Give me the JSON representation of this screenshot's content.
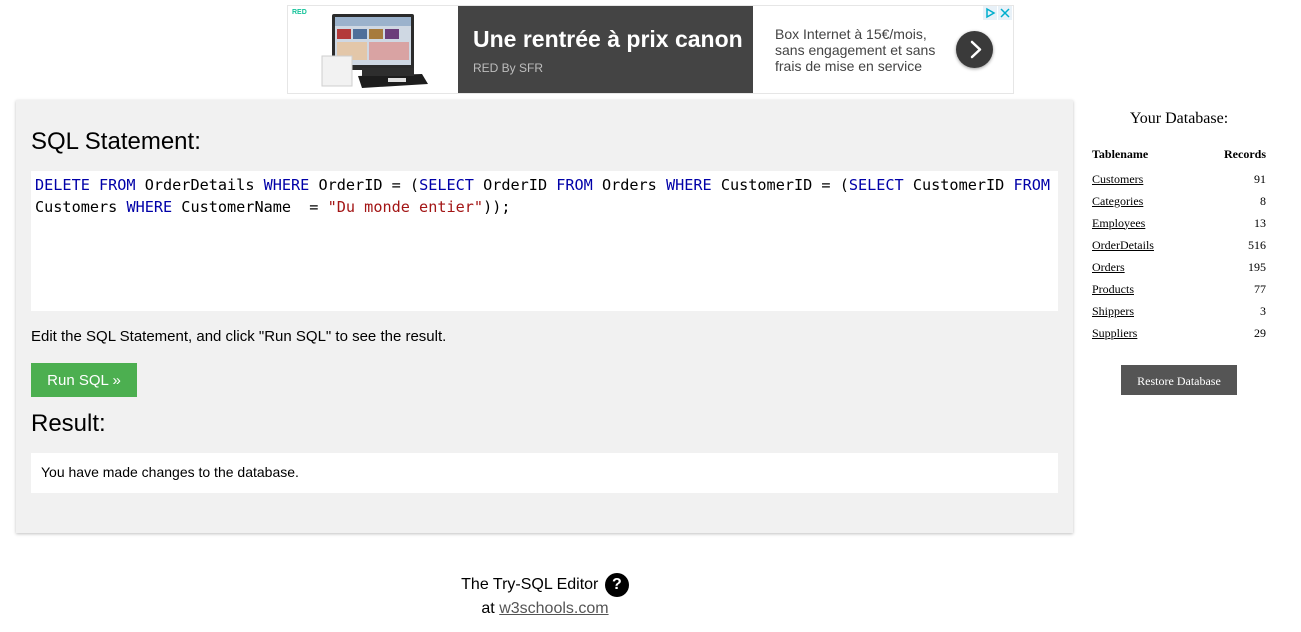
{
  "ad": {
    "logo_mark": "RED",
    "headline": "Une rentrée à prix canon",
    "advertiser": "RED By SFR",
    "body": "Box Internet à 15€/mois, sans engagement et sans frais de mise en service",
    "cta_icon": "chevron-right-icon",
    "colors": {
      "dark_bg": "#444444",
      "brand": "#15c39a"
    }
  },
  "editor": {
    "heading": "SQL Statement:",
    "sql_tokens": [
      {
        "t": "DELETE FROM",
        "k": "kw"
      },
      {
        "t": " OrderDetails ",
        "k": ""
      },
      {
        "t": "WHERE",
        "k": "kw"
      },
      {
        "t": " OrderID = (",
        "k": ""
      },
      {
        "t": "SELECT",
        "k": "kw"
      },
      {
        "t": " OrderID ",
        "k": ""
      },
      {
        "t": "FROM",
        "k": "kw"
      },
      {
        "t": " Orders ",
        "k": ""
      },
      {
        "t": "WHERE",
        "k": "kw"
      },
      {
        "t": " CustomerID = (",
        "k": ""
      },
      {
        "t": "SELECT",
        "k": "kw"
      },
      {
        "t": " CustomerID ",
        "k": ""
      },
      {
        "t": "FROM",
        "k": "kw"
      },
      {
        "t": "\nCustomers ",
        "k": ""
      },
      {
        "t": "WHERE",
        "k": "kw"
      },
      {
        "t": " CustomerName  = ",
        "k": ""
      },
      {
        "t": "\"Du monde entier\"",
        "k": "str"
      },
      {
        "t": "));",
        "k": ""
      }
    ],
    "hint": "Edit the SQL Statement, and click \"Run SQL\" to see the result.",
    "run_label": "Run SQL »",
    "result_heading": "Result:",
    "result_message": "You have made changes to the database.",
    "colors": {
      "run_button": "#4caf50",
      "keyword": "#0000a8",
      "string": "#a31515"
    }
  },
  "database": {
    "title": "Your Database:",
    "col_tablename": "Tablename",
    "col_records": "Records",
    "tables": [
      {
        "name": "Customers",
        "records": "91"
      },
      {
        "name": "Categories",
        "records": "8"
      },
      {
        "name": "Employees",
        "records": "13"
      },
      {
        "name": "OrderDetails",
        "records": "516"
      },
      {
        "name": "Orders",
        "records": "195"
      },
      {
        "name": "Products",
        "records": "77"
      },
      {
        "name": "Shippers",
        "records": "3"
      },
      {
        "name": "Suppliers",
        "records": "29"
      }
    ],
    "restore_label": "Restore Database"
  },
  "footer": {
    "line1": "The Try-SQL Editor",
    "help_glyph": "?",
    "at": "at",
    "link": "w3schools.com"
  }
}
